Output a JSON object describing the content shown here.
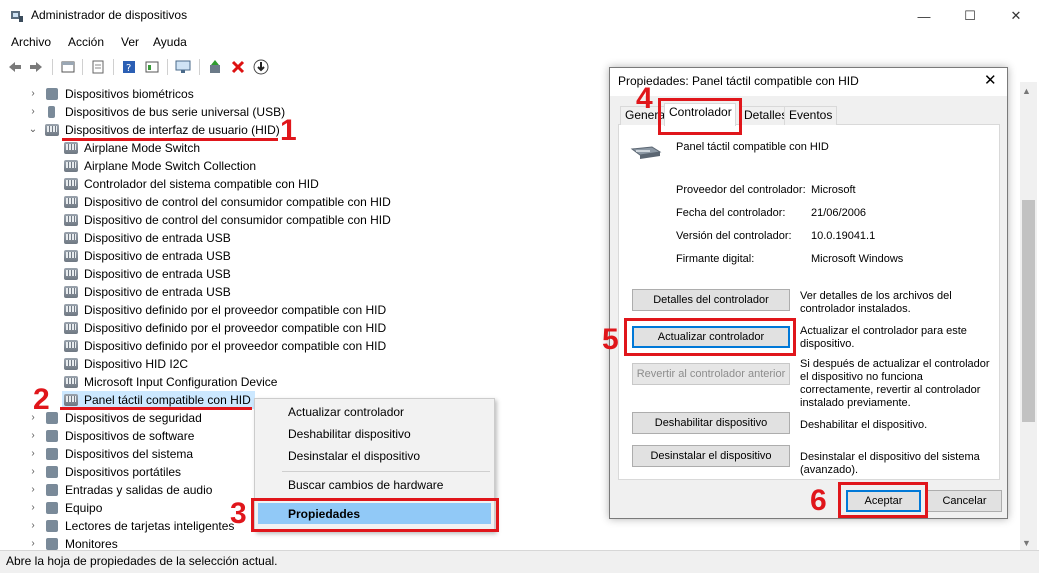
{
  "window": {
    "title": "Administrador de dispositivos",
    "minimize": "—",
    "maximize": "☐",
    "close": "✕"
  },
  "menu": [
    "Archivo",
    "Acción",
    "Ver",
    "Ayuda"
  ],
  "toolbar_icons": [
    "back-icon",
    "forward-icon",
    "properties-icon",
    "print-icon",
    "help-icon",
    "view-icon",
    "monitor-icon",
    "update-driver-icon",
    "uninstall-icon",
    "download-icon"
  ],
  "tree": {
    "top_items": [
      {
        "label": "Dispositivos biométricos",
        "expanded": false
      },
      {
        "label": "Dispositivos de bus serie universal (USB)",
        "expanded": false
      },
      {
        "label": "Dispositivos de interfaz de usuario (HID)",
        "expanded": true
      }
    ],
    "hid_children": [
      "Airplane Mode Switch",
      "Airplane Mode Switch Collection",
      "Controlador del sistema compatible con HID",
      "Dispositivo de control del consumidor compatible con HID",
      "Dispositivo de control del consumidor compatible con HID",
      "Dispositivo de entrada USB",
      "Dispositivo de entrada USB",
      "Dispositivo de entrada USB",
      "Dispositivo de entrada USB",
      "Dispositivo definido por el proveedor compatible con HID",
      "Dispositivo definido por el proveedor compatible con HID",
      "Dispositivo definido por el proveedor compatible con HID",
      "Dispositivo HID I2C",
      "Microsoft Input Configuration Device",
      "Panel táctil compatible con HID"
    ],
    "bottom_items": [
      "Dispositivos de seguridad",
      "Dispositivos de software",
      "Dispositivos del sistema",
      "Dispositivos portátiles",
      "Entradas y salidas de audio",
      "Equipo",
      "Lectores de tarjetas inteligentes",
      "Monitores"
    ]
  },
  "context_menu": {
    "items": [
      "Actualizar controlador",
      "Deshabilitar dispositivo",
      "Desinstalar el dispositivo",
      "Buscar cambios de hardware",
      "Propiedades"
    ]
  },
  "status": "Abre la hoja de propiedades de la selección actual.",
  "dialog": {
    "title": "Propiedades: Panel táctil compatible con HID",
    "close": "✕",
    "tabs": [
      "Genera",
      "Controlador",
      "Detalles",
      "Eventos"
    ],
    "device_name": "Panel táctil compatible con HID",
    "fields": [
      {
        "label": "Proveedor del controlador:",
        "value": "Microsoft"
      },
      {
        "label": "Fecha del controlador:",
        "value": "21/06/2006"
      },
      {
        "label": "Versión del controlador:",
        "value": "10.0.19041.1"
      },
      {
        "label": "Firmante digital:",
        "value": "Microsoft Windows"
      }
    ],
    "buttons": [
      {
        "label": "Detalles del controlador",
        "desc": "Ver detalles de los archivos del controlador instalados."
      },
      {
        "label": "Actualizar controlador",
        "desc": "Actualizar el controlador para este dispositivo."
      },
      {
        "label": "Revertir al controlador anterior",
        "desc": "Si después de actualizar el controlador el dispositivo no funciona correctamente, revertir al controlador instalado previamente."
      },
      {
        "label": "Deshabilitar dispositivo",
        "desc": "Deshabilitar el dispositivo."
      },
      {
        "label": "Desinstalar el dispositivo",
        "desc": "Desinstalar el dispositivo del sistema (avanzado)."
      }
    ],
    "ok": "Aceptar",
    "cancel": "Cancelar"
  },
  "annotations": [
    "1",
    "2",
    "3",
    "4",
    "5",
    "6"
  ],
  "colors": {
    "annotation": "#e0161b",
    "selection": "#cce8ff",
    "menu_highlight": "#91c9f7",
    "focus": "#0078d7"
  }
}
